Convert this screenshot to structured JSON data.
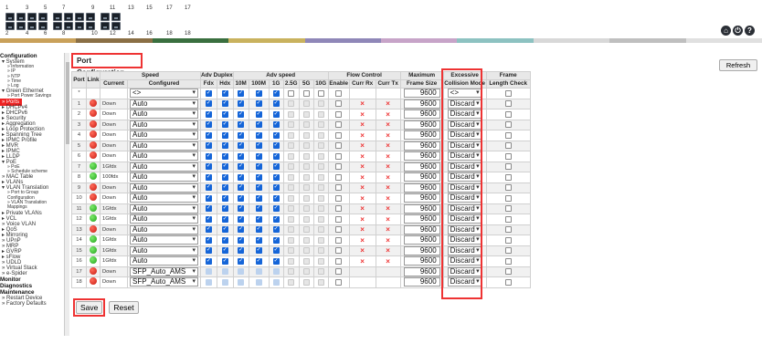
{
  "header": {
    "port_numbers_top": [
      "1",
      "3",
      "5",
      "7",
      "9",
      "11",
      "13",
      "15",
      "17",
      "17"
    ],
    "port_numbers_bottom": [
      "2",
      "4",
      "6",
      "8",
      "10",
      "12",
      "14",
      "16",
      "18",
      "18"
    ],
    "color_bar": [
      "#c9a15a",
      "#8a6f45",
      "#3a6f3f",
      "#c9b25e",
      "#8f87b8",
      "#c7a4c8",
      "#8dc2c1",
      "#d8d8d8",
      "#bfbfbf",
      "#e0e0e0"
    ],
    "icons": [
      "home-icon",
      "logout-icon",
      "help-icon"
    ]
  },
  "sidebar": {
    "items": [
      {
        "label": "Configuration",
        "level": 0
      },
      {
        "label": "▾ System",
        "level": 1
      },
      {
        "label": "» Information",
        "level": 2
      },
      {
        "label": "» IP",
        "level": 2
      },
      {
        "label": "» NTP",
        "level": 2
      },
      {
        "label": "» Time",
        "level": 2
      },
      {
        "label": "» Log",
        "level": 2
      },
      {
        "label": "▾ Green Ethernet",
        "level": 1
      },
      {
        "label": "» Port Power Savings",
        "level": 2
      },
      {
        "label": "» Ports",
        "level": 1,
        "active": true
      },
      {
        "label": "▸ DHCPv4",
        "level": 1
      },
      {
        "label": "▸ DHCPv6",
        "level": 1
      },
      {
        "label": "▸ Security",
        "level": 1
      },
      {
        "label": "▸ Aggregation",
        "level": 1
      },
      {
        "label": "▸ Loop Protection",
        "level": 1
      },
      {
        "label": "▸ Spanning Tree",
        "level": 1
      },
      {
        "label": "▸ IPMC Profile",
        "level": 1
      },
      {
        "label": "▸ MVR",
        "level": 1
      },
      {
        "label": "▸ IPMC",
        "level": 1
      },
      {
        "label": "▸ LLDP",
        "level": 1
      },
      {
        "label": "▾ PoE",
        "level": 1
      },
      {
        "label": "» PoE",
        "level": 2
      },
      {
        "label": "» Schedule scheme",
        "level": 2
      },
      {
        "label": "» MAC Table",
        "level": 1
      },
      {
        "label": "▸ VLANs",
        "level": 1
      },
      {
        "label": "▾ VLAN Translation",
        "level": 1
      },
      {
        "label": "» Port to Group",
        "level": 2
      },
      {
        "label": "Configuration",
        "level": 2
      },
      {
        "label": "» VLAN Translation",
        "level": 2
      },
      {
        "label": "Mappings",
        "level": 2
      },
      {
        "label": "▸ Private VLANs",
        "level": 1
      },
      {
        "label": "▸ VCL",
        "level": 1
      },
      {
        "label": "» Voice VLAN",
        "level": 1
      },
      {
        "label": "▸ QoS",
        "level": 1
      },
      {
        "label": "▸ Mirroring",
        "level": 1
      },
      {
        "label": "» UPnP",
        "level": 1
      },
      {
        "label": "» MRP",
        "level": 1
      },
      {
        "label": "▸ GVRP",
        "level": 1
      },
      {
        "label": "▸ sFlow",
        "level": 1
      },
      {
        "label": "» UDLD",
        "level": 1
      },
      {
        "label": "» Virtual Stack",
        "level": 1
      },
      {
        "label": "» e-Spider",
        "level": 1
      },
      {
        "label": "Monitor",
        "level": 0
      },
      {
        "label": "Diagnostics",
        "level": 0
      },
      {
        "label": "Maintenance",
        "level": 0
      },
      {
        "label": "» Restart Device",
        "level": 1
      },
      {
        "label": "» Factory Defaults",
        "level": 1
      }
    ]
  },
  "main": {
    "title": "Port Configuration",
    "refresh_label": "Refresh",
    "save_label": "Save",
    "reset_label": "Reset",
    "headers": {
      "port": "Port",
      "link": "Link",
      "speed": "Speed",
      "current": "Current",
      "configured": "Configured",
      "adv_duplex": "Adv Duplex",
      "fdx": "Fdx",
      "hdx": "Hdx",
      "adv_speed": "Adv speed",
      "s10m": "10M",
      "s100m": "100M",
      "s1g": "1G",
      "s25g": "2.5G",
      "s5g": "5G",
      "s10g": "10G",
      "flow_control": "Flow Control",
      "enable": "Enable",
      "curr_rx": "Curr Rx",
      "curr_tx": "Curr Tx",
      "max_frame_1": "Maximum",
      "max_frame_2": "Frame Size",
      "excessive_1": "Excessive",
      "excessive_2": "Collision Mode",
      "frame_len_1": "Frame",
      "frame_len_2": "Length Check"
    },
    "wildcard_row": {
      "port": "*",
      "configured": "<>",
      "max_frame": "9600",
      "collision": "<>"
    },
    "rows": [
      {
        "port": "1",
        "link": "red",
        "current": "Down",
        "configured": "Auto",
        "max_frame": "9600",
        "collision": "Discard"
      },
      {
        "port": "2",
        "link": "red",
        "current": "Down",
        "configured": "Auto",
        "max_frame": "9600",
        "collision": "Discard"
      },
      {
        "port": "3",
        "link": "red",
        "current": "Down",
        "configured": "Auto",
        "max_frame": "9600",
        "collision": "Discard"
      },
      {
        "port": "4",
        "link": "red",
        "current": "Down",
        "configured": "Auto",
        "max_frame": "9600",
        "collision": "Discard"
      },
      {
        "port": "5",
        "link": "red",
        "current": "Down",
        "configured": "Auto",
        "max_frame": "9600",
        "collision": "Discard"
      },
      {
        "port": "6",
        "link": "red",
        "current": "Down",
        "configured": "Auto",
        "max_frame": "9600",
        "collision": "Discard"
      },
      {
        "port": "7",
        "link": "green",
        "current": "1Gfdx",
        "configured": "Auto",
        "max_frame": "9600",
        "collision": "Discard"
      },
      {
        "port": "8",
        "link": "green",
        "current": "100fdx",
        "configured": "Auto",
        "max_frame": "9600",
        "collision": "Discard"
      },
      {
        "port": "9",
        "link": "red",
        "current": "Down",
        "configured": "Auto",
        "max_frame": "9600",
        "collision": "Discard"
      },
      {
        "port": "10",
        "link": "red",
        "current": "Down",
        "configured": "Auto",
        "max_frame": "9600",
        "collision": "Discard"
      },
      {
        "port": "11",
        "link": "green",
        "current": "1Gfdx",
        "configured": "Auto",
        "max_frame": "9600",
        "collision": "Discard"
      },
      {
        "port": "12",
        "link": "green",
        "current": "1Gfdx",
        "configured": "Auto",
        "max_frame": "9600",
        "collision": "Discard"
      },
      {
        "port": "13",
        "link": "red",
        "current": "Down",
        "configured": "Auto",
        "max_frame": "9600",
        "collision": "Discard"
      },
      {
        "port": "14",
        "link": "green",
        "current": "1Gfdx",
        "configured": "Auto",
        "max_frame": "9600",
        "collision": "Discard"
      },
      {
        "port": "15",
        "link": "green",
        "current": "1Gfdx",
        "configured": "Auto",
        "max_frame": "9600",
        "collision": "Discard"
      },
      {
        "port": "16",
        "link": "green",
        "current": "1Gfdx",
        "configured": "Auto",
        "max_frame": "9600",
        "collision": "Discard"
      },
      {
        "port": "17",
        "link": "red",
        "current": "Down",
        "configured": "SFP_Auto_AMS",
        "max_frame": "9600",
        "collision": "Discard"
      },
      {
        "port": "18",
        "link": "red",
        "current": "Down",
        "configured": "SFP_Auto_AMS",
        "max_frame": "9600",
        "collision": "Discard"
      }
    ]
  }
}
